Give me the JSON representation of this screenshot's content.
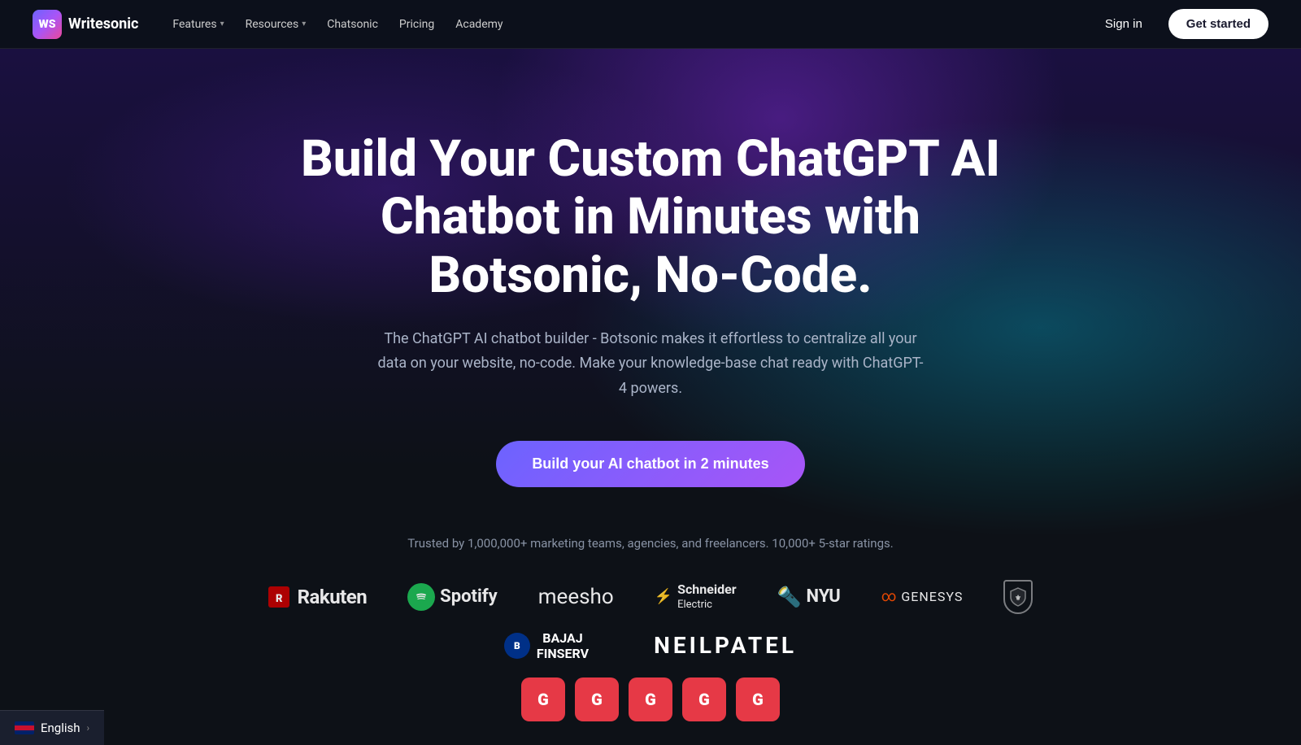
{
  "nav": {
    "logo_text": "Writesonic",
    "logo_abbr": "WS",
    "links": [
      {
        "label": "Features",
        "has_dropdown": true
      },
      {
        "label": "Resources",
        "has_dropdown": true
      },
      {
        "label": "Chatsonic",
        "has_dropdown": false
      },
      {
        "label": "Pricing",
        "has_dropdown": false
      },
      {
        "label": "Academy",
        "has_dropdown": false
      }
    ],
    "sign_in": "Sign in",
    "get_started": "Get started"
  },
  "hero": {
    "title": "Build Your Custom ChatGPT AI Chatbot in Minutes with Botsonic, No-Code.",
    "subtitle": "The ChatGPT AI chatbot builder - Botsonic makes it effortless to centralize all your data on your website, no-code. Make your knowledge-base chat ready with ChatGPT-4 powers.",
    "cta_label": "Build your AI chatbot in 2 minutes"
  },
  "trusted": {
    "text": "Trusted by 1,000,000+ marketing teams, agencies, and freelancers. 10,000+ 5-star ratings.",
    "logos": [
      {
        "name": "Rakuten",
        "type": "rakuten"
      },
      {
        "name": "Spotify",
        "type": "spotify"
      },
      {
        "name": "meesho",
        "type": "meesho"
      },
      {
        "name": "Schneider Electric",
        "type": "schneider"
      },
      {
        "name": "NYU",
        "type": "nyu"
      },
      {
        "name": "GENESYS",
        "type": "genesys"
      },
      {
        "name": "shield",
        "type": "shield"
      }
    ],
    "logos_row2": [
      {
        "name": "BAJAJ FINSERV",
        "type": "bajaj"
      },
      {
        "name": "NEILPATEL",
        "type": "neilpatel"
      }
    ]
  },
  "language": {
    "label": "English",
    "chevron": "›"
  }
}
